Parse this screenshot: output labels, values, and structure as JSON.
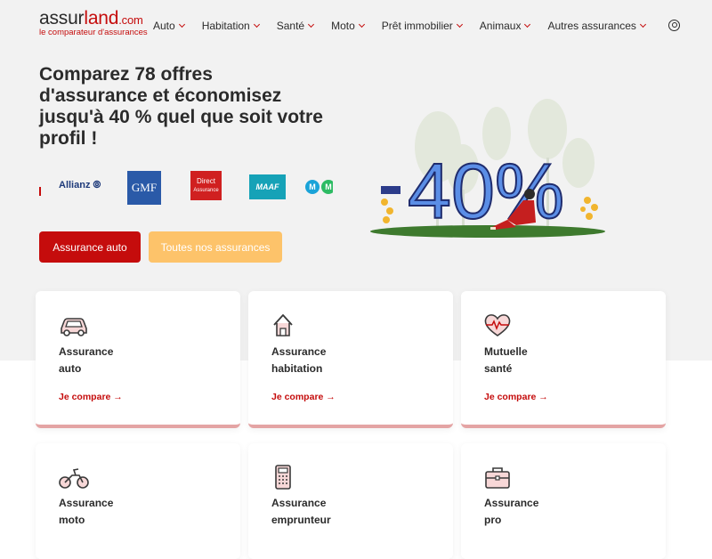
{
  "header": {
    "logo_part1": "assur",
    "logo_part2": "land",
    "logo_domain": ".com",
    "logo_tagline": "le comparateur d'assurances",
    "nav": [
      "Auto",
      "Habitation",
      "Santé",
      "Moto",
      "Prêt immobilier",
      "Animaux",
      "Autres assurances"
    ],
    "user_icon": "user-circle-icon"
  },
  "hero": {
    "headline": "Comparez 78 offres d'assurance et économisez jusqu'à 40 % quel que soit votre profil !",
    "insurer_logos": {
      "allianz": "Allianz ⦾",
      "gmf": "GMF",
      "direct_line1": "Direct",
      "direct_line2": "Assurance",
      "maaf": "MAAF",
      "mm1": "M",
      "mm2": "M"
    },
    "btn_auto": "Assurance auto",
    "btn_all": "Toutes nos assurances",
    "illustration_text": "-40%"
  },
  "cards": [
    {
      "title_l1": "Assurance",
      "title_l2": "auto",
      "link": "Je compare →",
      "icon": "car-icon"
    },
    {
      "title_l1": "Assurance",
      "title_l2": "habitation",
      "link": "Je compare →",
      "icon": "house-icon"
    },
    {
      "title_l1": "Mutuelle",
      "title_l2": "santé",
      "link": "Je compare →",
      "icon": "heart-pulse-icon"
    },
    {
      "title_l1": "Assurance",
      "title_l2": "moto",
      "icon": "motorcycle-icon"
    },
    {
      "title_l1": "Assurance",
      "title_l2": "emprunteur",
      "icon": "calculator-icon"
    },
    {
      "title_l1": "Assurance",
      "title_l2": "pro",
      "icon": "briefcase-icon"
    }
  ],
  "colors": {
    "brand_red": "#c50c0c",
    "accent_yellow": "#fdc36a",
    "hero_bg": "#f2f2f2",
    "illustration_blue": "#5b8ee6"
  }
}
